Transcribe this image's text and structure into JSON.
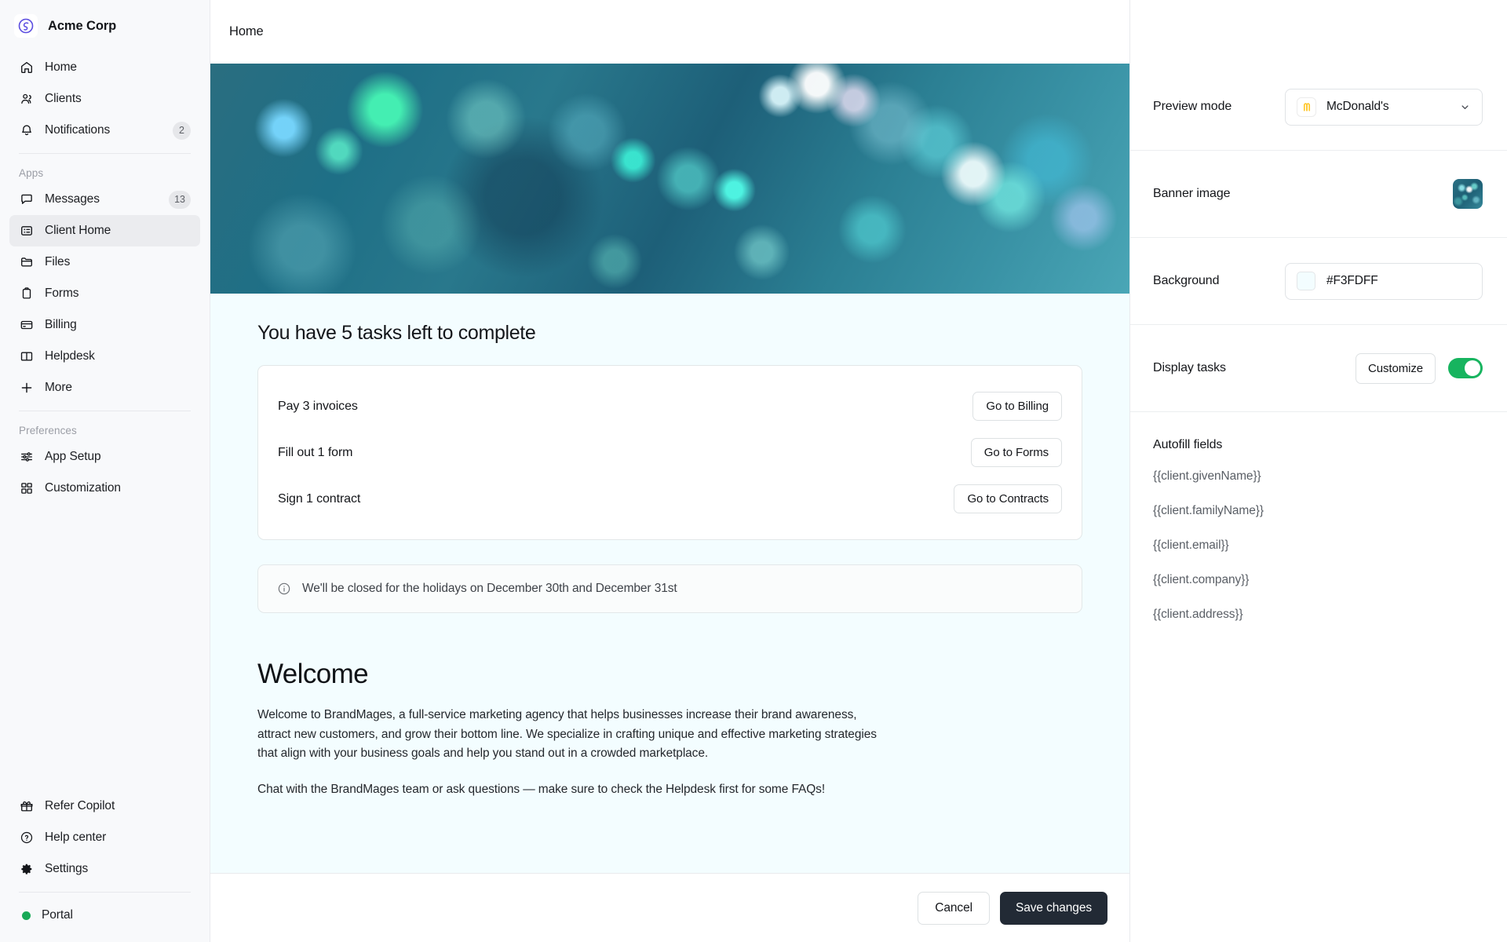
{
  "sidebar": {
    "brand": {
      "name": "Acme Corp",
      "logo_icon": "acme-circle-logo",
      "logo_color": "#5b4de0"
    },
    "primary_items": [
      {
        "label": "Home",
        "icon": "home-icon",
        "badge": ""
      },
      {
        "label": "Clients",
        "icon": "users-icon",
        "badge": ""
      },
      {
        "label": "Notifications",
        "icon": "bell-icon",
        "badge": "2"
      }
    ],
    "apps_group_label": "Apps",
    "apps_items": [
      {
        "label": "Messages",
        "icon": "chat-bubble-icon",
        "badge": "13"
      },
      {
        "label": "Client Home",
        "icon": "client-home-icon",
        "badge": "",
        "active": true
      },
      {
        "label": "Files",
        "icon": "folder-icon",
        "badge": ""
      },
      {
        "label": "Forms",
        "icon": "clipboard-icon",
        "badge": ""
      },
      {
        "label": "Billing",
        "icon": "credit-card-icon",
        "badge": ""
      },
      {
        "label": "Helpdesk",
        "icon": "book-open-icon",
        "badge": ""
      },
      {
        "label": "More",
        "icon": "plus-icon",
        "badge": ""
      }
    ],
    "preferences_group_label": "Preferences",
    "preferences_items": [
      {
        "label": "App Setup",
        "icon": "sliders-icon",
        "badge": ""
      },
      {
        "label": "Customization",
        "icon": "grid-squares-icon",
        "badge": ""
      }
    ],
    "footer_items": [
      {
        "label": "Refer Copilot",
        "icon": "gift-icon"
      },
      {
        "label": "Help center",
        "icon": "question-circle-icon"
      },
      {
        "label": "Settings",
        "icon": "gear-icon"
      }
    ],
    "portal": {
      "label": "Portal",
      "icon": "green-status-dot",
      "dot_color": "#18a957"
    }
  },
  "topbar": {
    "title": "Home"
  },
  "preview": {
    "background_color": "#F3FDFF",
    "banner_alt": "teal glitter bokeh banner image",
    "tasks_heading": "You have 5 tasks left to complete",
    "tasks": [
      {
        "label": "Pay 3 invoices",
        "button": "Go to Billing"
      },
      {
        "label": "Fill out 1 form",
        "button": "Go to Forms"
      },
      {
        "label": "Sign 1 contract",
        "button": "Go to Contracts"
      }
    ],
    "notice": {
      "icon": "info-circle-icon",
      "text": "We'll be closed for the holidays on December 30th and December 31st"
    },
    "welcome_heading": "Welcome",
    "welcome_paragraphs": [
      "Welcome to BrandMages, a full-service marketing agency that helps businesses increase their brand awareness, attract new customers, and grow their bottom line. We specialize in crafting unique and effective marketing strategies that align with your business goals and help you stand out in a crowded marketplace.",
      "Chat with the BrandMages team or ask questions — make sure to check the Helpdesk first for some FAQs!"
    ]
  },
  "actionbar": {
    "cancel_label": "Cancel",
    "save_label": "Save changes"
  },
  "settings_panel": {
    "preview_mode": {
      "label": "Preview mode",
      "selected_value": "McDonald's",
      "brand_icon": "mcdonalds-golden-arches-icon",
      "chevron_icon": "chevron-down-icon"
    },
    "banner_image": {
      "label": "Banner image",
      "thumbnail_icon": "banner-thumbnail"
    },
    "background": {
      "label": "Background",
      "value": "#F3FDFF",
      "swatch_color": "#F3FDFF"
    },
    "display_tasks": {
      "label": "Display tasks",
      "customize_label": "Customize",
      "toggle_state": "on",
      "toggle_color": "#17B45F"
    },
    "autofill": {
      "title": "Autofill fields",
      "fields": [
        "{{client.givenName}}",
        "{{client.familyName}}",
        "{{client.email}}",
        "{{client.company}}",
        "{{client.address}}"
      ]
    }
  }
}
